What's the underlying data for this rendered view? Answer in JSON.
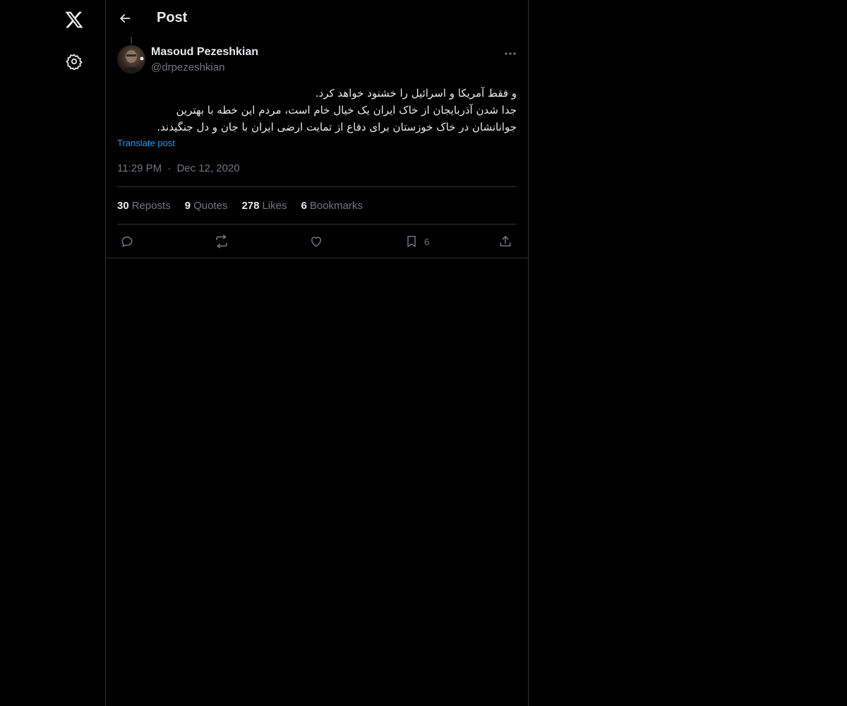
{
  "nav": {
    "logo_icon": "x-logo-icon",
    "settings_icon": "gear-icon"
  },
  "header": {
    "title": "Post",
    "back_icon": "arrow-left-icon"
  },
  "post": {
    "author": {
      "name": "Masoud Pezeshkian",
      "handle": "@drpezeshkian"
    },
    "text_lines": [
      "و فقط آمریکا و اسرائیل را خشنود خواهد کرد.",
      "جدا شدن آذربایجان از خاک ایران یک خیال خام است، مردم این خطه با بهترین",
      "جوانانشان در خاک خوزستان برای دفاع از تمایت ارضی ایران با جان و دل جنگیدند."
    ],
    "translate_label": "Translate post",
    "time": "11:29 PM",
    "separator": "·",
    "date": "Dec 12, 2020",
    "stats": {
      "reposts_count": "30",
      "reposts_label": "Reposts",
      "quotes_count": "9",
      "quotes_label": "Quotes",
      "likes_count": "278",
      "likes_label": "Likes",
      "bookmarks_count": "6",
      "bookmarks_label": "Bookmarks"
    },
    "actions": {
      "bookmark_count": "6"
    }
  },
  "colors": {
    "background": "#000000",
    "text": "#e7e9ea",
    "muted": "#71767b",
    "accent": "#1d9bf0",
    "border": "#2f3336"
  }
}
